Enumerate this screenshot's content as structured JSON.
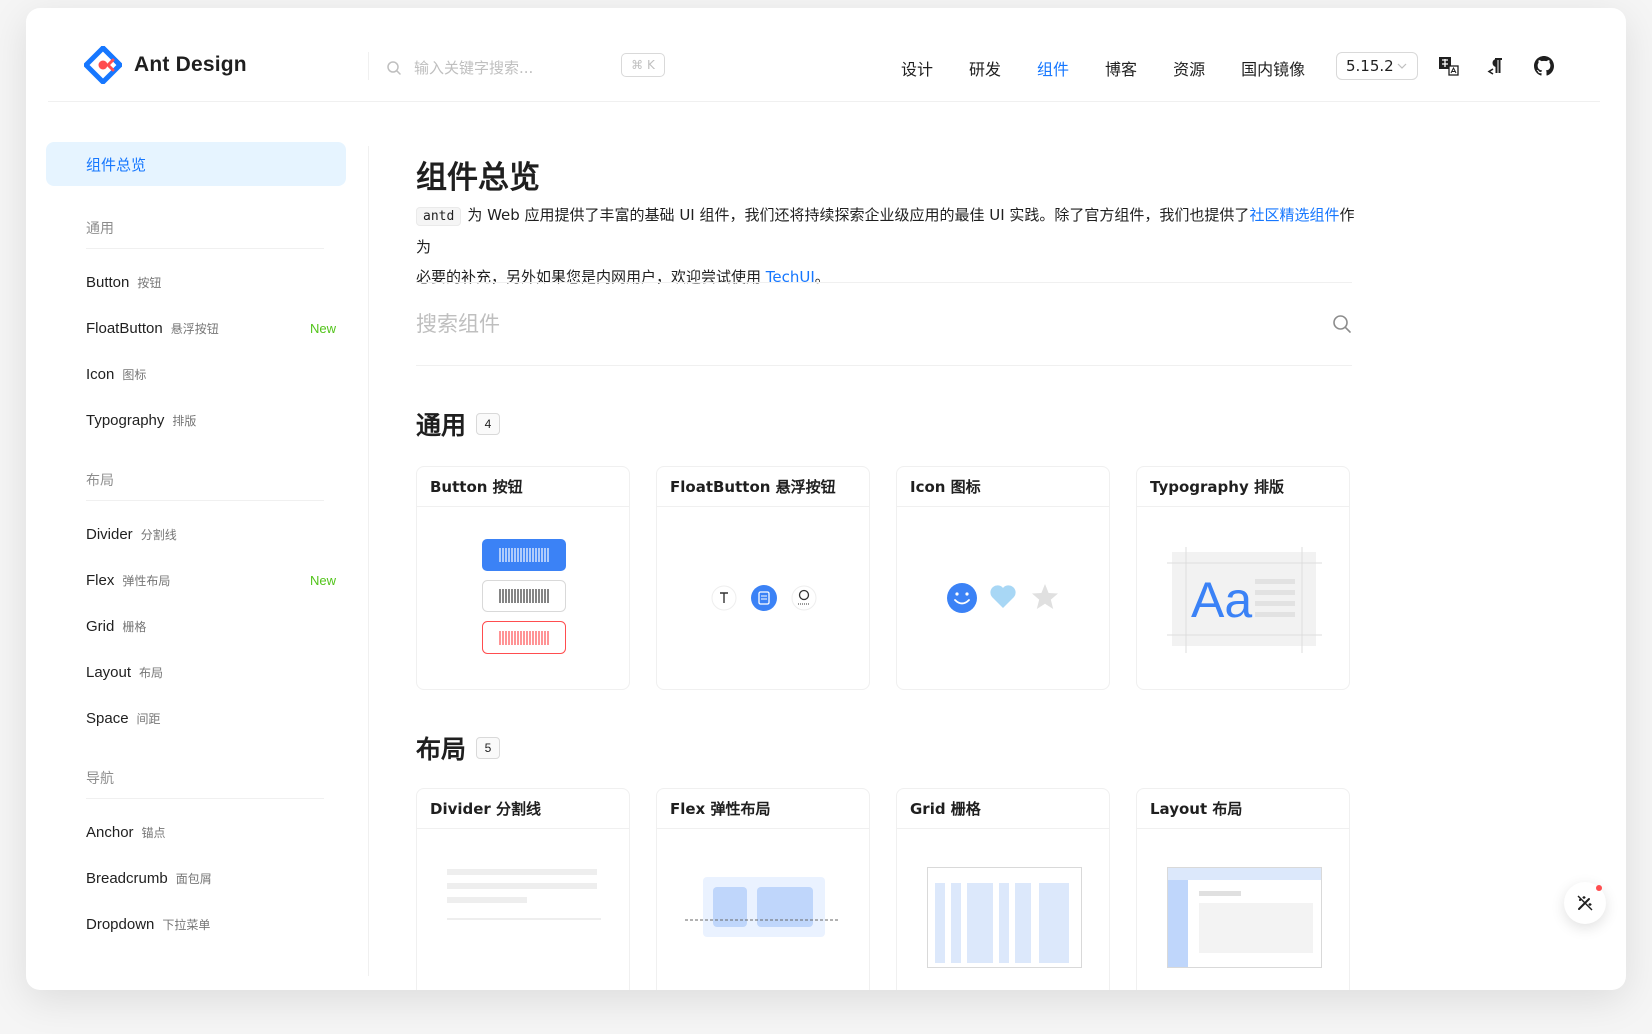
{
  "header": {
    "logo_text": "Ant Design",
    "search_placeholder": "输入关键字搜索...",
    "shortcut": "⌘ K",
    "nav": [
      "设计",
      "研发",
      "组件",
      "博客",
      "资源",
      "国内镜像"
    ],
    "active_nav": "组件",
    "version": "5.15.2"
  },
  "sidebar": {
    "active": "组件总览",
    "groups": [
      {
        "label": "通用",
        "items": [
          {
            "en": "Button",
            "zh": "按钮",
            "tag": ""
          },
          {
            "en": "FloatButton",
            "zh": "悬浮按钮",
            "tag": "New"
          },
          {
            "en": "Icon",
            "zh": "图标",
            "tag": ""
          },
          {
            "en": "Typography",
            "zh": "排版",
            "tag": ""
          }
        ]
      },
      {
        "label": "布局",
        "items": [
          {
            "en": "Divider",
            "zh": "分割线",
            "tag": ""
          },
          {
            "en": "Flex",
            "zh": "弹性布局",
            "tag": "New"
          },
          {
            "en": "Grid",
            "zh": "栅格",
            "tag": ""
          },
          {
            "en": "Layout",
            "zh": "布局",
            "tag": ""
          },
          {
            "en": "Space",
            "zh": "间距",
            "tag": ""
          }
        ]
      },
      {
        "label": "导航",
        "items": [
          {
            "en": "Anchor",
            "zh": "锚点",
            "tag": ""
          },
          {
            "en": "Breadcrumb",
            "zh": "面包屑",
            "tag": ""
          },
          {
            "en": "Dropdown",
            "zh": "下拉菜单",
            "tag": ""
          }
        ]
      }
    ]
  },
  "main": {
    "title": "组件总览",
    "intro_code": "antd",
    "intro_part1": "为 Web 应用提供了丰富的基础 UI 组件，我们还将持续探索企业级应用的最佳 UI 实践。除了官方组件，我们也提供了",
    "intro_link1": "社区精选组件",
    "intro_part2": "作为",
    "intro_part3": "必要的补充，另外如果您是内网用户，欢迎尝试使用 ",
    "intro_link2": "TechUI",
    "intro_part4": "。",
    "search_placeholder": "搜索组件",
    "sections": [
      {
        "title": "通用",
        "count": "4",
        "cards": [
          "Button 按钮",
          "FloatButton 悬浮按钮",
          "Icon 图标",
          "Typography 排版"
        ]
      },
      {
        "title": "布局",
        "count": "5",
        "cards": [
          "Divider 分割线",
          "Flex 弹性布局",
          "Grid 栅格",
          "Layout 布局"
        ]
      }
    ]
  },
  "colors": {
    "primary": "#1677ff",
    "danger": "#ff4d4f",
    "success": "#52c41a",
    "active_bg": "#e6f4ff"
  }
}
